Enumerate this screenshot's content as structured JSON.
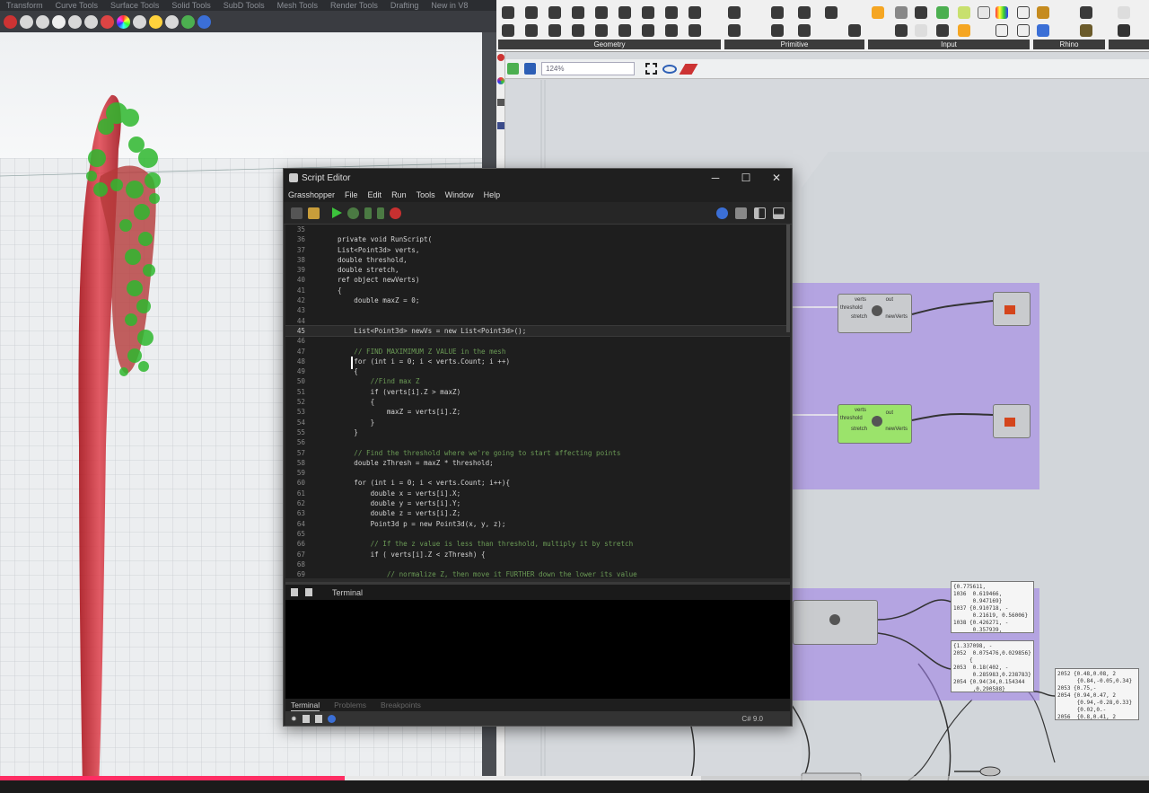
{
  "rhino": {
    "tabs": [
      "Transform",
      "Curve Tools",
      "Surface Tools",
      "Solid Tools",
      "SubD Tools",
      "Mesh Tools",
      "Render Tools",
      "Drafting",
      "New in V8"
    ]
  },
  "grasshopper": {
    "ribbon_groups": [
      "Geometry",
      "Primitive",
      "Input",
      "Rhino"
    ],
    "zoom": "124%",
    "panels": [
      "{0.775611,\n1036  0.619466,\n      0.947169}\n1037 {0.910718, -\n      0.21619, 0.56006}\n1038 {0.426271, -\n      0.357939,\n      0.22378}",
      "{1.337098, -\n2052  0.075476,0.029856}\n     {\n2053  0.18(402, -\n      0.285983,0.238783}\n2054 {0.94(34,0.154344\n      ,0.290588}",
      "2052 {0.48,0.08, 2\n      {0.84,-0.05,0.34}\n2053 {0.75,-\n2054 {0.94,0.47, 2\n      {0.94,-0.28,0.33}\n      {0.02,0.-\n2056  {0.8,0.41, 2\n      {0.94,0.15,0.33}"
    ]
  },
  "editor": {
    "title": "Script Editor",
    "menu": [
      "Grasshopper",
      "File",
      "Edit",
      "Run",
      "Tools",
      "Window",
      "Help"
    ],
    "code_lines": [
      {
        "n": "35",
        "t": ""
      },
      {
        "n": "36",
        "t": "private void RunScript("
      },
      {
        "n": "37",
        "t": "List<Point3d> verts,"
      },
      {
        "n": "38",
        "t": "double threshold,"
      },
      {
        "n": "39",
        "t": "double stretch,"
      },
      {
        "n": "40",
        "t": "ref object newVerts)"
      },
      {
        "n": "41",
        "t": "{"
      },
      {
        "n": "42",
        "t": "    double maxZ = 0;"
      },
      {
        "n": "43",
        "t": ""
      },
      {
        "n": "44",
        "t": ""
      },
      {
        "n": "45",
        "t": "    List<Point3d> newVs = new List<Point3d>();"
      },
      {
        "n": "46",
        "t": ""
      },
      {
        "n": "47",
        "t": "    // FIND MAXIMIMUM Z VALUE in the mesh"
      },
      {
        "n": "48",
        "t": "    for (int i = 0; i < verts.Count; i ++)"
      },
      {
        "n": "49",
        "t": "    {"
      },
      {
        "n": "50",
        "t": "        //Find max Z"
      },
      {
        "n": "51",
        "t": "        if (verts[i].Z > maxZ)"
      },
      {
        "n": "52",
        "t": "        {"
      },
      {
        "n": "53",
        "t": "            maxZ = verts[i].Z;"
      },
      {
        "n": "54",
        "t": "        }"
      },
      {
        "n": "55",
        "t": "    }"
      },
      {
        "n": "56",
        "t": ""
      },
      {
        "n": "57",
        "t": "    // Find the threshold where we're going to start affecting points"
      },
      {
        "n": "58",
        "t": "    double zThresh = maxZ * threshold;"
      },
      {
        "n": "59",
        "t": ""
      },
      {
        "n": "60",
        "t": "    for (int i = 0; i < verts.Count; i++){"
      },
      {
        "n": "61",
        "t": "        double x = verts[i].X;"
      },
      {
        "n": "62",
        "t": "        double y = verts[i].Y;"
      },
      {
        "n": "63",
        "t": "        double z = verts[i].Z;"
      },
      {
        "n": "64",
        "t": "        Point3d p = new Point3d(x, y, z);"
      },
      {
        "n": "65",
        "t": ""
      },
      {
        "n": "66",
        "t": "        // If the z value is less than threshold, multiply it by stretch"
      },
      {
        "n": "67",
        "t": "        if ( verts[i].Z < zThresh) {"
      },
      {
        "n": "68",
        "t": ""
      },
      {
        "n": "69",
        "t": "            // normalize Z, then move it FURTHER down the lower its value"
      }
    ],
    "terminal_tab": "Terminal",
    "bottom_tabs": [
      "Terminal",
      "Problems",
      "Breakpoints"
    ],
    "language": "C# 9.0"
  },
  "video": {
    "played_fraction": 0.3,
    "buffered_fraction": 0.61
  }
}
